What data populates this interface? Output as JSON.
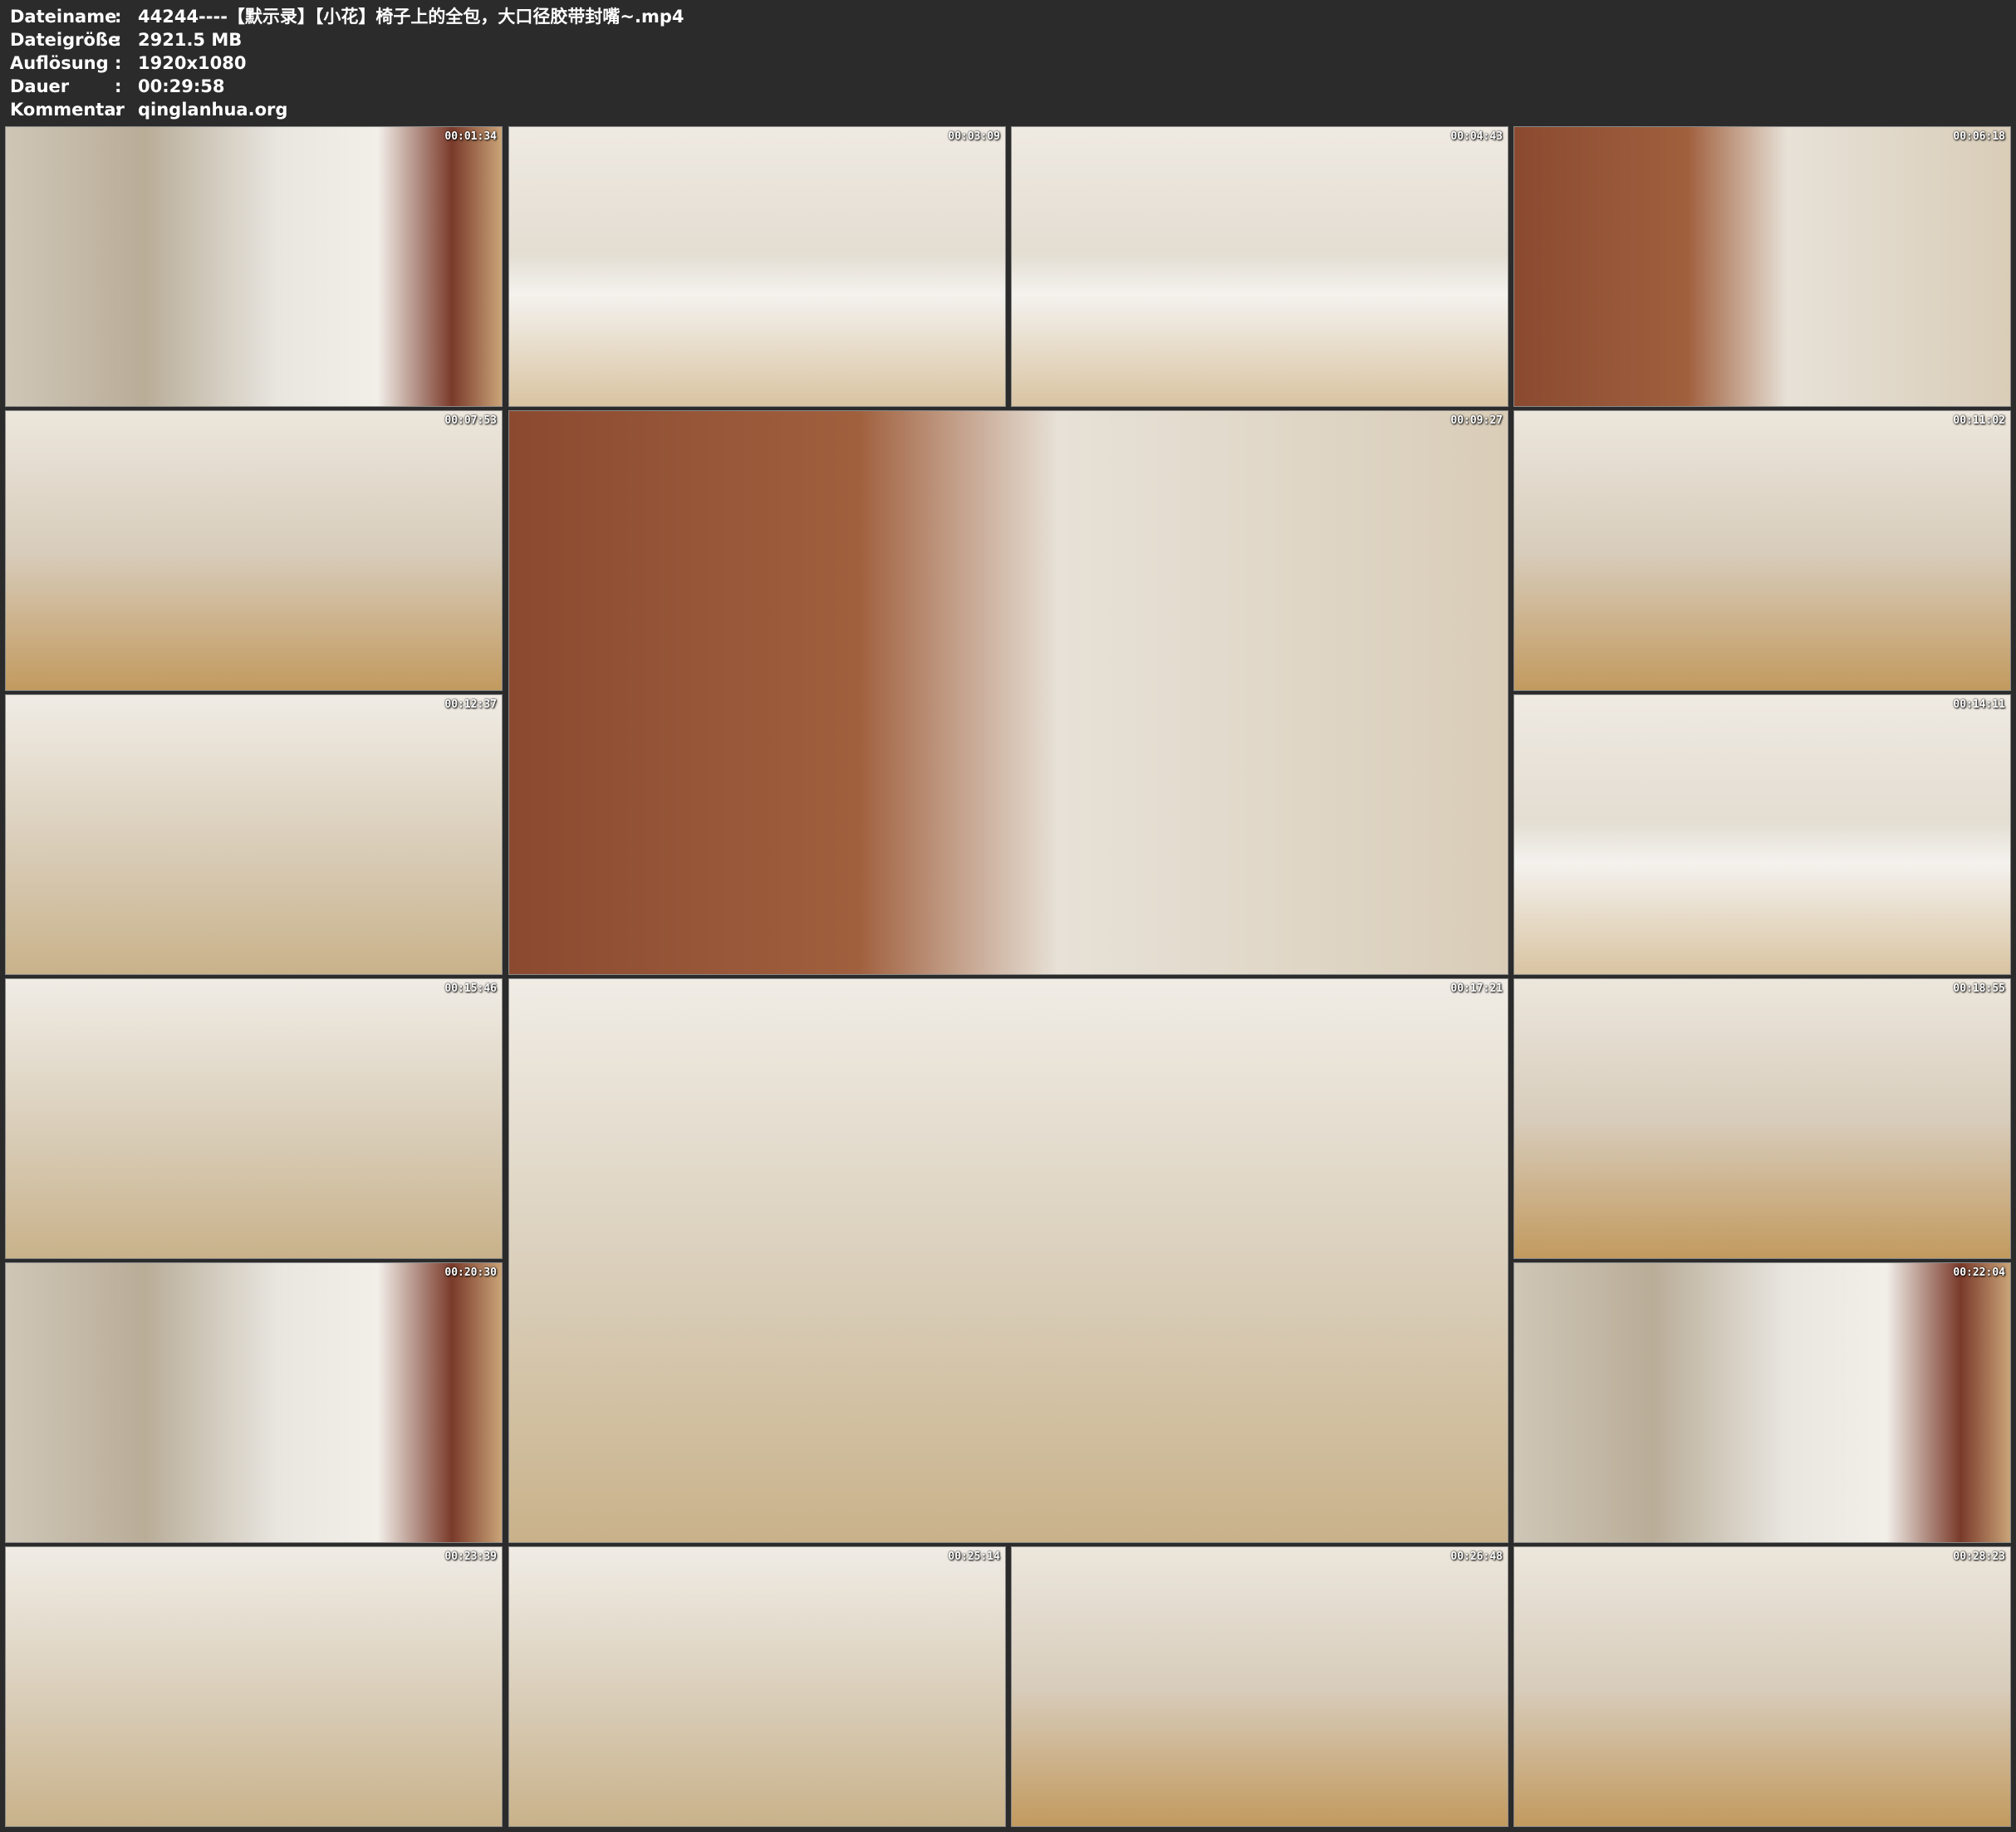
{
  "meta": {
    "filename_label": "Dateiname",
    "filename": "44244----【默示录】【小花】椅子上的全包，大口径胶带封嘴~.mp4",
    "filesize_label": "Dateigröße",
    "filesize": "2921.5 MB",
    "resolution_label": "Auflösung",
    "resolution": "1920x1080",
    "duration_label": "Dauer",
    "duration": "00:29:58",
    "comment_label": "Kommentar",
    "comment": "qinglanhua.org",
    "separator": ":"
  },
  "thumbnails": [
    {
      "timestamp": "00:01:34",
      "scene": "s1"
    },
    {
      "timestamp": "00:03:09",
      "scene": "s2"
    },
    {
      "timestamp": "00:04:43",
      "scene": "s2"
    },
    {
      "timestamp": "00:06:18",
      "scene": "s4"
    },
    {
      "timestamp": "00:07:53",
      "scene": "s3"
    },
    {
      "timestamp": "00:09:27",
      "scene": "s4"
    },
    {
      "timestamp": "00:11:02",
      "scene": "s3"
    },
    {
      "timestamp": "00:12:37",
      "scene": "s5"
    },
    {
      "timestamp": "00:14:11",
      "scene": "s2"
    },
    {
      "timestamp": "00:15:46",
      "scene": "s5"
    },
    {
      "timestamp": "00:17:21",
      "scene": "s5"
    },
    {
      "timestamp": "00:18:55",
      "scene": "s3"
    },
    {
      "timestamp": "00:20:30",
      "scene": "s1"
    },
    {
      "timestamp": "00:22:04",
      "scene": "s1"
    },
    {
      "timestamp": "00:23:39",
      "scene": "s5"
    },
    {
      "timestamp": "00:25:14",
      "scene": "s5"
    },
    {
      "timestamp": "00:26:48",
      "scene": "s3"
    },
    {
      "timestamp": "00:28:23",
      "scene": "s3"
    }
  ]
}
